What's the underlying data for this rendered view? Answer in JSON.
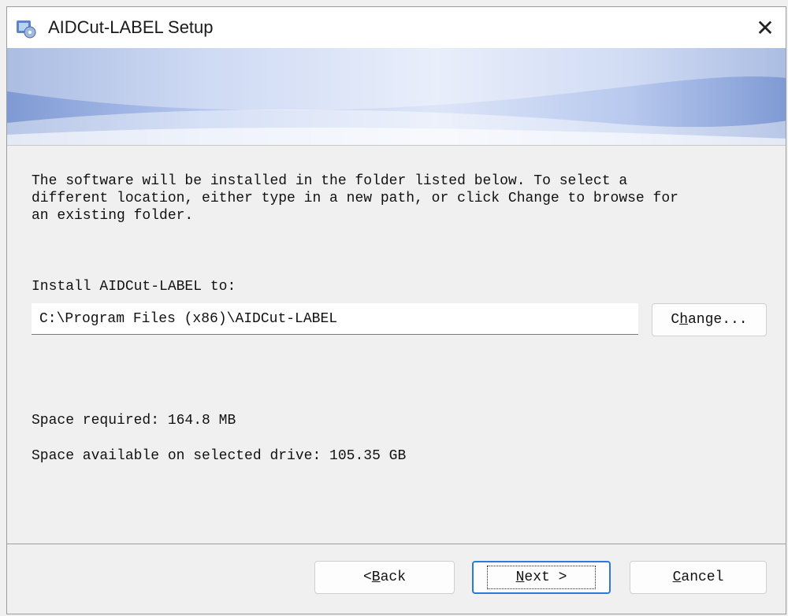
{
  "window": {
    "title": "AIDCut-LABEL Setup",
    "close_glyph": "✕",
    "icon": "installer-icon"
  },
  "banner": {
    "colors": [
      "#7f9ad4",
      "#dde5f8",
      "#ffffff"
    ]
  },
  "content": {
    "description": "The software will be installed in the folder listed below. To select a\ndifferent location, either type in a new path, or click Change to browse for\nan existing folder.",
    "install_label": "Install AIDCut-LABEL to:",
    "install_path": "C:\\Program Files (x86)\\AIDCut-LABEL",
    "change_button": {
      "pre": "C",
      "accel": "h",
      "post": "ange..."
    },
    "space_required": "Space required: 164.8 MB",
    "space_available": "Space available on selected drive: 105.35 GB"
  },
  "footer": {
    "back_button": {
      "pre": "< ",
      "accel": "B",
      "post": "ack"
    },
    "next_button": {
      "pre": "",
      "accel": "N",
      "post": "ext >"
    },
    "cancel_button": {
      "pre": "",
      "accel": "C",
      "post": "ancel"
    }
  },
  "colors": {
    "focus_border": "#2c7ad6",
    "background": "#f0f0f0"
  }
}
